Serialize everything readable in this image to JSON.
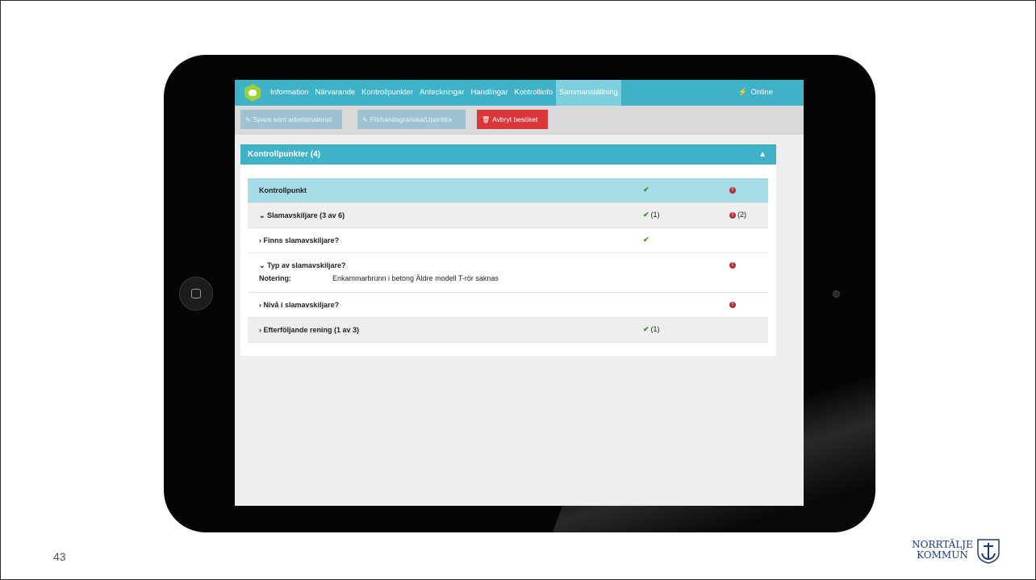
{
  "app": {
    "nav_tabs": [
      {
        "label": "Information",
        "active": false
      },
      {
        "label": "Närvarande",
        "active": false
      },
      {
        "label": "Kontrollpunkter",
        "active": false
      },
      {
        "label": "Anteckningar",
        "active": false
      },
      {
        "label": "Handlingar",
        "active": false
      },
      {
        "label": "Kontrollinfo",
        "active": false
      },
      {
        "label": "Sammanställning",
        "active": true
      }
    ],
    "status": {
      "icon": "lightning-icon",
      "label": "Online"
    },
    "toolbar": {
      "save_label": "Spara som arbetsmaterial",
      "preview_label": "Förhandsgranska/Upprätta",
      "cancel_label": "Avbryt besöket"
    },
    "panel": {
      "title": "Kontrollpunkter (4)",
      "table": {
        "header": {
          "label": "Kontrollpunkt",
          "ok_icon": "check-icon",
          "error_icon": "exclamation-icon"
        },
        "rows": [
          {
            "expand": "chevron-down",
            "label": "Slamavskiljare (3 av 6)",
            "ok_count": "(1)",
            "error_count": "(2)"
          },
          {
            "expand": "chevron-right",
            "label": "Finns slamavskiljare?",
            "ok": true
          },
          {
            "expand": "chevron-down",
            "label": "Typ av slamavskiljare?",
            "error": true,
            "note_label": "Notering:",
            "note_text": "Enkammarbrunn i betong Äldre modell T-rör saknas"
          },
          {
            "expand": "chevron-right",
            "label": "Nivå i slamavskiljare?",
            "error": true
          },
          {
            "expand": "chevron-right",
            "label": "Efterföljande rening (1 av 3)",
            "ok_count": "(1)"
          }
        ]
      }
    }
  },
  "slide": {
    "page_number": "43",
    "brand_line1": "NORRTÄLJE",
    "brand_line2": "KOMMUN"
  },
  "colors": {
    "accent": "#3fb2c8",
    "header_row": "#a6dbe8",
    "ok": "#3d8b22",
    "error": "#b0303a",
    "cancel_button": "#d9383a",
    "disabled_button": "#9dc3d3"
  }
}
